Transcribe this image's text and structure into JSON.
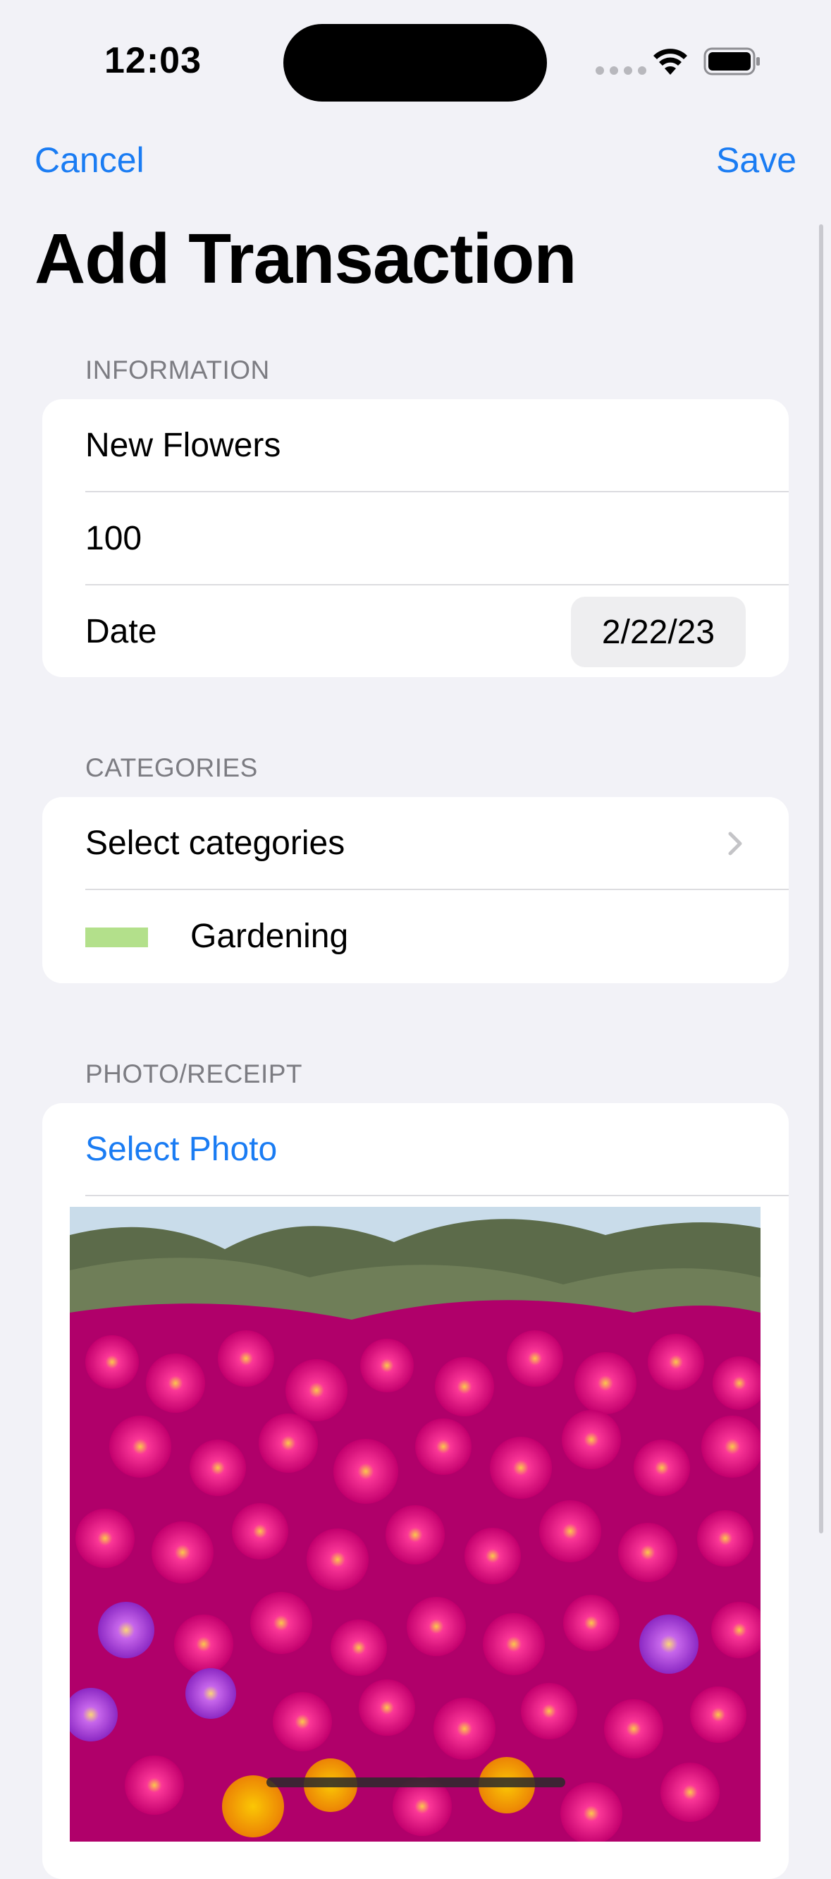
{
  "status_bar": {
    "time": "12:03"
  },
  "nav": {
    "cancel_label": "Cancel",
    "save_label": "Save",
    "title": "Add Transaction"
  },
  "information": {
    "header": "INFORMATION",
    "name_value": "New Flowers",
    "amount_value": "100",
    "date_label": "Date",
    "date_value": "2/22/23"
  },
  "categories": {
    "header": "CATEGORIES",
    "select_label": "Select categories",
    "items": [
      {
        "name": "Gardening",
        "color": "#b3e08b"
      }
    ]
  },
  "photo": {
    "header": "PHOTO/RECEIPT",
    "select_label": "Select Photo"
  },
  "colors": {
    "accent": "#1a7cf3",
    "background": "#f2f2f7"
  }
}
